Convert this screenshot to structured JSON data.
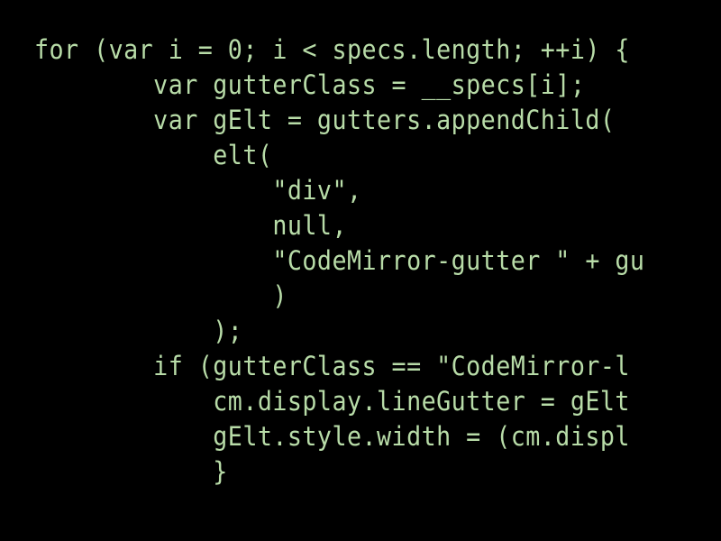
{
  "colors": {
    "background": "#000000",
    "text": "#b8dca8"
  },
  "code_lines": [
    "for (var i = 0; i < specs.length; ++i) {",
    "        var gutterClass = __specs[i];",
    "        var gElt = gutters.appendChild(",
    "            elt(",
    "                \"div\",",
    "                null,",
    "                \"CodeMirror-gutter \" + gu",
    "                )",
    "            );",
    "        if (gutterClass == \"CodeMirror-l",
    "            cm.display.lineGutter = gElt",
    "            gElt.style.width = (cm.displ",
    "            }"
  ]
}
